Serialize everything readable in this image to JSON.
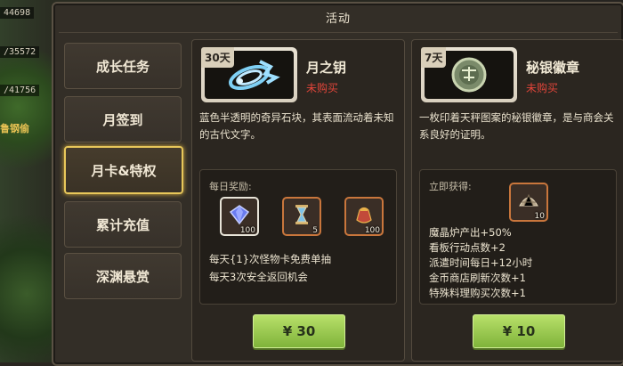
{
  "background": {
    "hp_values": [
      "44698",
      "/35572",
      "/41756"
    ],
    "gold_label": "鲁钢偷"
  },
  "window": {
    "title": "活动"
  },
  "sidebar": {
    "tabs": [
      {
        "label": "成长任务",
        "active": false
      },
      {
        "label": "月签到",
        "active": false
      },
      {
        "label": "月卡&特权",
        "active": true
      },
      {
        "label": "累计充值",
        "active": false
      },
      {
        "label": "深渊悬赏",
        "active": false
      }
    ]
  },
  "cards": [
    {
      "days": "30天",
      "name": "月之钥",
      "status": "未购买",
      "description": "蓝色半透明的奇异石块，其表面流动着未知的古代文字。",
      "reward_title": "每日奖励:",
      "items": [
        {
          "icon": "gem-icon",
          "qty": "100"
        },
        {
          "icon": "hourglass-icon",
          "qty": "5"
        },
        {
          "icon": "pouch-icon",
          "qty": "100"
        }
      ],
      "perks": [
        "每天{1}次怪物卡免费单抽",
        "每天3次安全返回机会"
      ],
      "price": "¥ 30"
    },
    {
      "days": "7天",
      "name": "秘银徽章",
      "status": "未购买",
      "description": "一枚印着天秤图案的秘银徽章，是与商会关系良好的证明。",
      "reward_title": "立即获得:",
      "items": [
        {
          "icon": "shell-icon",
          "qty": "10"
        }
      ],
      "perks": [
        "魔晶炉产出+50%",
        "看板行动点数+2",
        "派遣时间每日+12小时",
        "金币商店刷新次数+1",
        "特殊料理购买次数+1"
      ],
      "price": "¥ 10"
    }
  ],
  "colors": {
    "accent_gold": "#e8c75a",
    "status_red": "#e0453a",
    "button_green": "#9ccc50"
  }
}
